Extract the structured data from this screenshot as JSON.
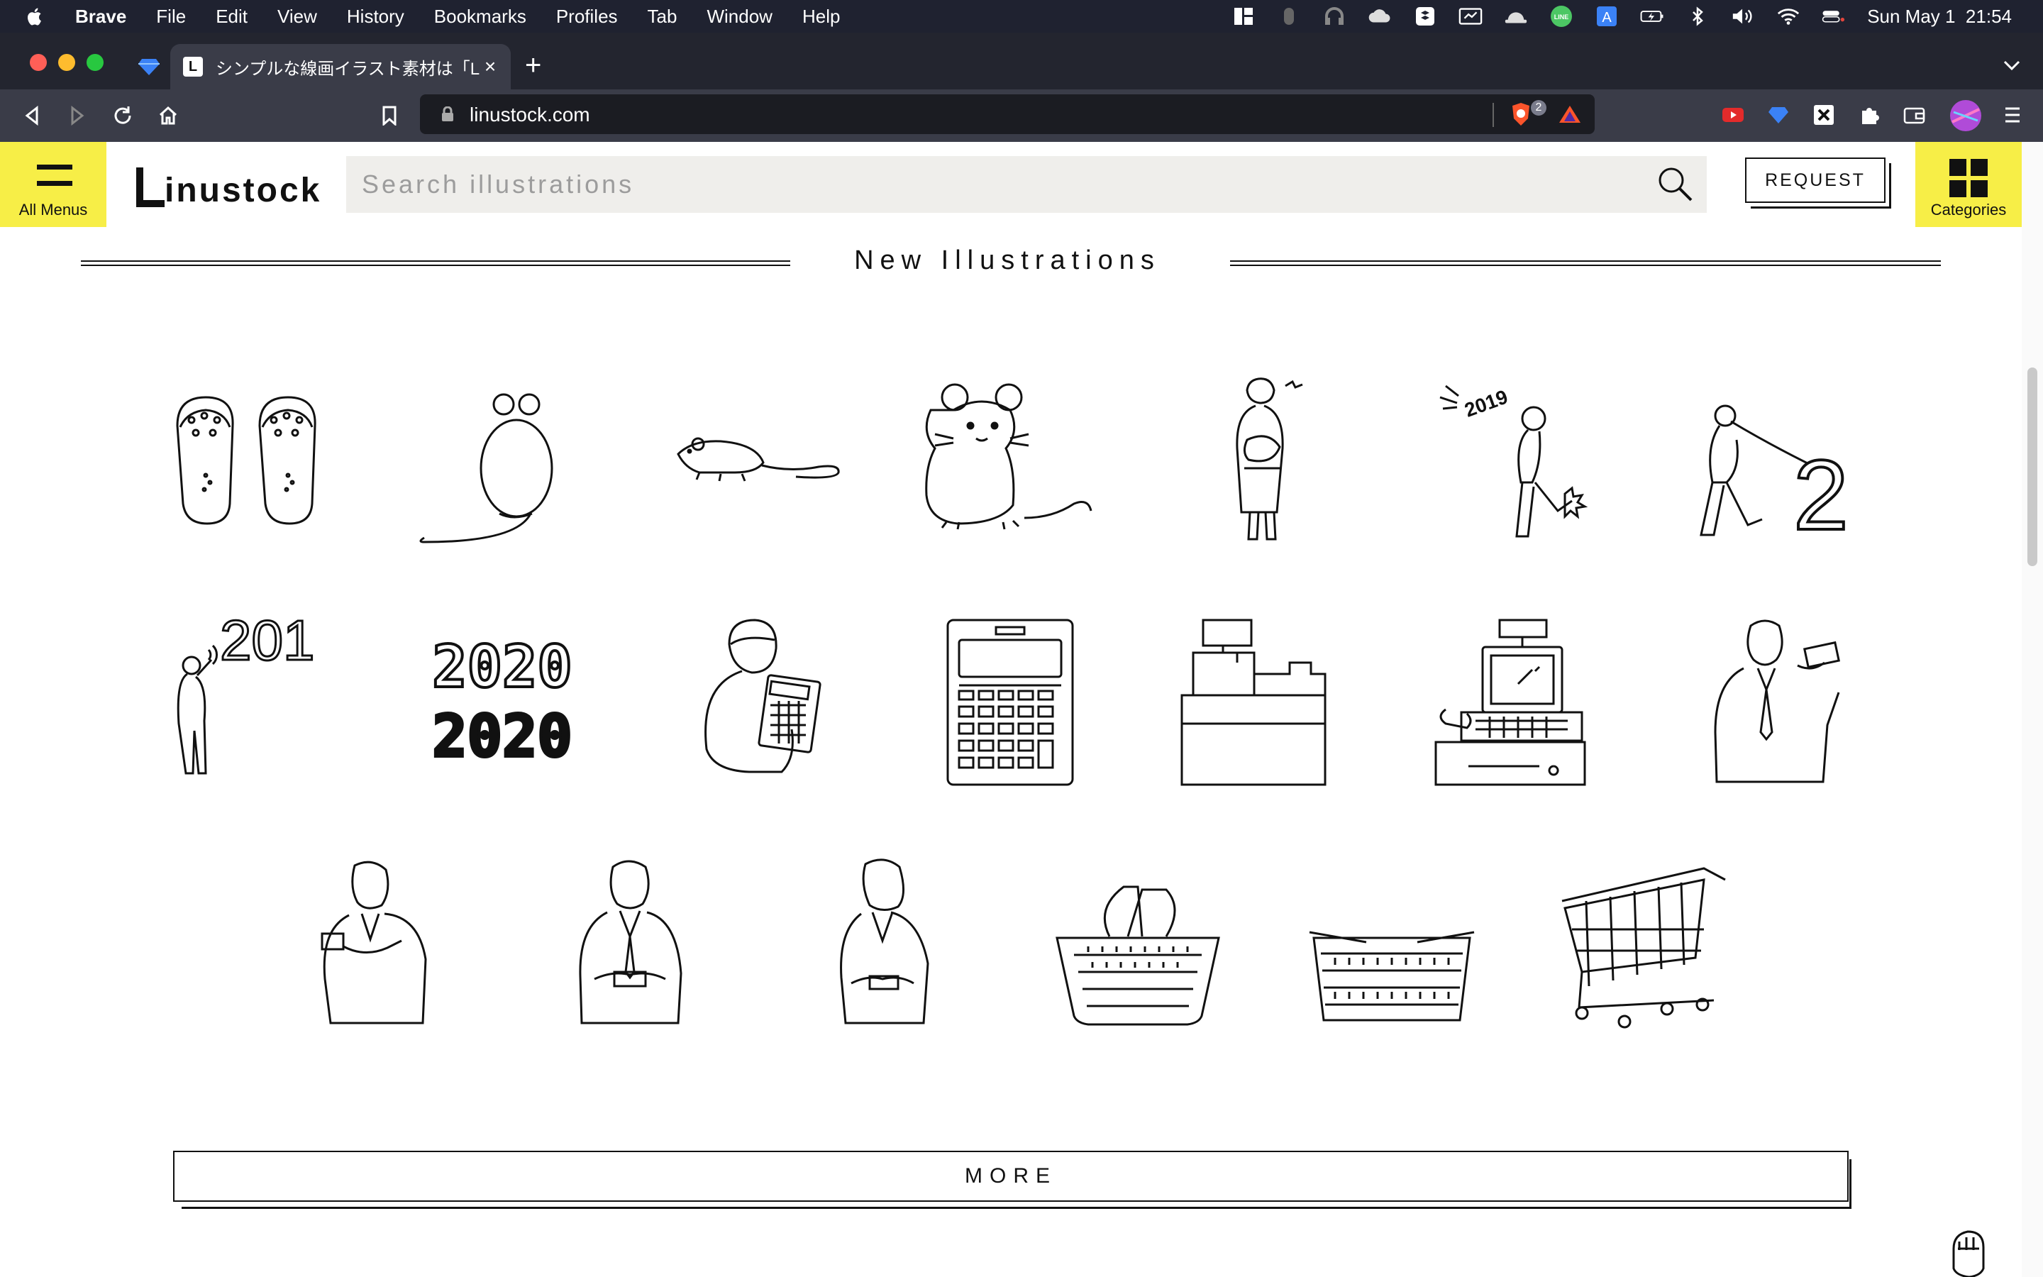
{
  "menubar": {
    "app": "Brave",
    "items": [
      "File",
      "Edit",
      "View",
      "History",
      "Bookmarks",
      "Profiles",
      "Tab",
      "Window",
      "Help"
    ],
    "datetime": "Sun May 1  21:54",
    "line_badge": "LINE",
    "input_badge": "A"
  },
  "browser": {
    "tab_title": "シンプルな線画イラスト素材は「Lin",
    "tab_favicon": "L",
    "url": "linustock.com",
    "shield_count": "2"
  },
  "site": {
    "all_menus_label": "All Menus",
    "logo_text": "inustock",
    "search_placeholder": "Search illustrations",
    "request_label": "REQUEST",
    "categories_label": "Categories",
    "section_title": "New Illustrations",
    "more_label": "MORE",
    "accent_color": "#f7ee47"
  },
  "illustrations": {
    "rows": [
      [
        "sandals",
        "rat-back",
        "mouse-walking",
        "mouse-sitting",
        "woman-holding-rat",
        "man-kicking-2019",
        "man-pulling-2"
      ],
      [
        "woman-speaking-201",
        "2020-text",
        "woman-calculator",
        "calculator",
        "cash-register",
        "pos-register",
        "businessman-card"
      ],
      [
        "businesswoman-card",
        "businessman-card-bow",
        "businesswoman-card-bow",
        "shopping-basket-handles",
        "shopping-basket-flat",
        "shopping-cart"
      ]
    ],
    "text": {
      "kick_year": "2019",
      "pull_digit": "2",
      "shout_digits": "201",
      "year_outline": "2020",
      "year_solid": "2020"
    }
  }
}
